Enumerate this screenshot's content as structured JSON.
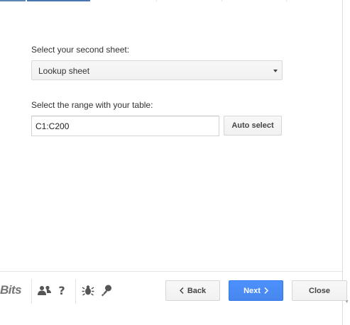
{
  "form": {
    "sheet_label": "Select your second sheet:",
    "sheet_value": "Lookup sheet",
    "range_label": "Select the range with your table:",
    "range_value": "C1:C200",
    "auto_select_label": "Auto select"
  },
  "footer": {
    "brand_text": "Bits",
    "help_label": "?",
    "back_label": "Back",
    "next_label": "Next",
    "close_label": "Close"
  },
  "icons": [
    "people-icon",
    "help-icon",
    "bug-icon",
    "idea-icon",
    "chevron-left-icon",
    "chevron-right-icon"
  ],
  "colors": {
    "accent": "#4d90fe",
    "tab_active": "#4a76b0"
  }
}
